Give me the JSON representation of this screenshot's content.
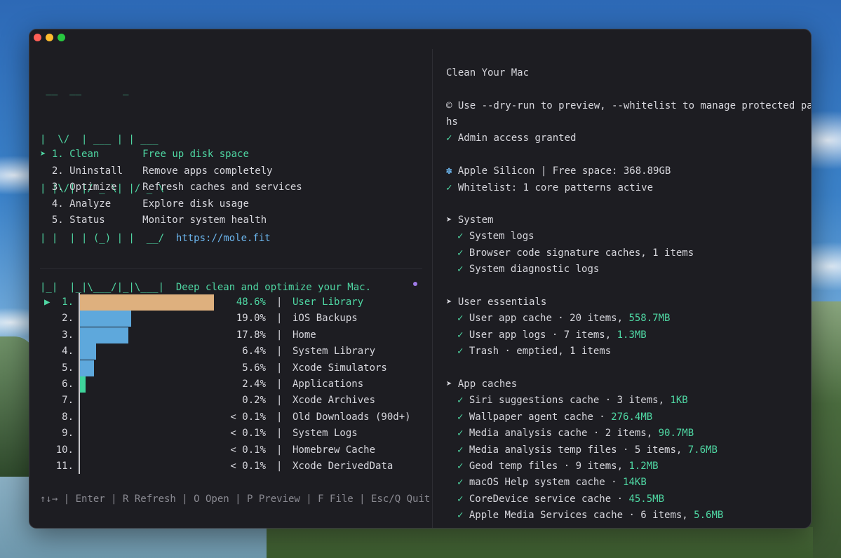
{
  "logo": {
    "ascii_lines": [
      " __  __       _",
      "|  \\/  | ___ | | ___",
      "| |\\/| |/ _ \\| |/ _ \\",
      "| |  | | (_) | |  __/",
      "|_|  |_|\\___/|_|\\___|"
    ],
    "url": "https://mole.fit",
    "tagline": "Deep clean and optimize your Mac."
  },
  "menu": {
    "selected_marker": "➤",
    "items": [
      {
        "num": "1.",
        "name": "Clean",
        "desc": "Free up disk space"
      },
      {
        "num": "2.",
        "name": "Uninstall",
        "desc": "Remove apps completely"
      },
      {
        "num": "3.",
        "name": "Optimize",
        "desc": "Refresh caches and services"
      },
      {
        "num": "4.",
        "name": "Analyze",
        "desc": "Explore disk usage"
      },
      {
        "num": "5.",
        "name": "Status",
        "desc": "Monitor system health"
      }
    ]
  },
  "analyze": {
    "selected_marker": "▶",
    "separator": "|",
    "rows": [
      {
        "num": "1.",
        "pct_label": "48.6%",
        "pct": 48.6,
        "label": "User Library",
        "color": "#deb07e"
      },
      {
        "num": "2.",
        "pct_label": "19.0%",
        "pct": 19.0,
        "label": "iOS Backups",
        "color": "#5ea8dc"
      },
      {
        "num": "3.",
        "pct_label": "17.8%",
        "pct": 17.8,
        "label": "Home",
        "color": "#5ea8dc"
      },
      {
        "num": "4.",
        "pct_label": "6.4%",
        "pct": 6.4,
        "label": "System Library",
        "color": "#5ea8dc"
      },
      {
        "num": "5.",
        "pct_label": "5.6%",
        "pct": 5.6,
        "label": "Xcode Simulators",
        "color": "#5ea8dc"
      },
      {
        "num": "6.",
        "pct_label": "2.4%",
        "pct": 2.4,
        "label": "Applications",
        "color": "#3fd39b"
      },
      {
        "num": "7.",
        "pct_label": "0.2%",
        "pct": 0.2,
        "label": "Xcode Archives",
        "color": "#3fd39b"
      },
      {
        "num": "8.",
        "pct_label": "< 0.1%",
        "pct": 0.0,
        "label": "Old Downloads (90d+)",
        "color": "#3fd39b"
      },
      {
        "num": "9.",
        "pct_label": "< 0.1%",
        "pct": 0.0,
        "label": "System Logs",
        "color": "#3fd39b"
      },
      {
        "num": "10.",
        "pct_label": "< 0.1%",
        "pct": 0.0,
        "label": "Homebrew Cache",
        "color": "#3fd39b"
      },
      {
        "num": "11.",
        "pct_label": "< 0.1%",
        "pct": 0.0,
        "label": "Xcode DerivedData",
        "color": "#3fd39b"
      }
    ]
  },
  "footer": {
    "help": "↑↓→ | Enter | R Refresh | O Open | P Preview | F File | Esc/Q Quit"
  },
  "right": {
    "title": "Clean Your Mac",
    "hint_line1": "© Use --dry-run to preview, --whitelist to manage protected pat",
    "hint_line2": "hs",
    "admin": "Admin access granted",
    "silicon": "Apple Silicon | Free space: 368.89GB",
    "whitelist": "Whitelist: 1 core patterns active",
    "check": "✓",
    "section_marker": "➤",
    "gear": "✽",
    "sections": [
      {
        "title": "System",
        "items": [
          {
            "text": "System logs",
            "size": ""
          },
          {
            "text": "Browser code signature caches, 1 items",
            "size": ""
          },
          {
            "text": "System diagnostic logs",
            "size": ""
          }
        ]
      },
      {
        "title": "User essentials",
        "items": [
          {
            "text": "User app cache · 20 items, ",
            "size": "558.7MB"
          },
          {
            "text": "User app logs · 7 items, ",
            "size": "1.3MB"
          },
          {
            "text": "Trash · emptied, 1 items",
            "size": ""
          }
        ]
      },
      {
        "title": "App caches",
        "items": [
          {
            "text": "Siri suggestions cache · 3 items, ",
            "size": "1KB"
          },
          {
            "text": "Wallpaper agent cache · ",
            "size": "276.4MB"
          },
          {
            "text": "Media analysis cache · 2 items, ",
            "size": "90.7MB"
          },
          {
            "text": "Media analysis temp files · 5 items, ",
            "size": "7.6MB"
          },
          {
            "text": "Geod temp files · 9 items, ",
            "size": "1.2MB"
          },
          {
            "text": "macOS Help system cache · ",
            "size": "14KB"
          },
          {
            "text": "CoreDevice service cache · ",
            "size": "45.5MB"
          },
          {
            "text": "Apple Media Services cache · 6 items, ",
            "size": "5.6MB"
          }
        ]
      }
    ]
  }
}
